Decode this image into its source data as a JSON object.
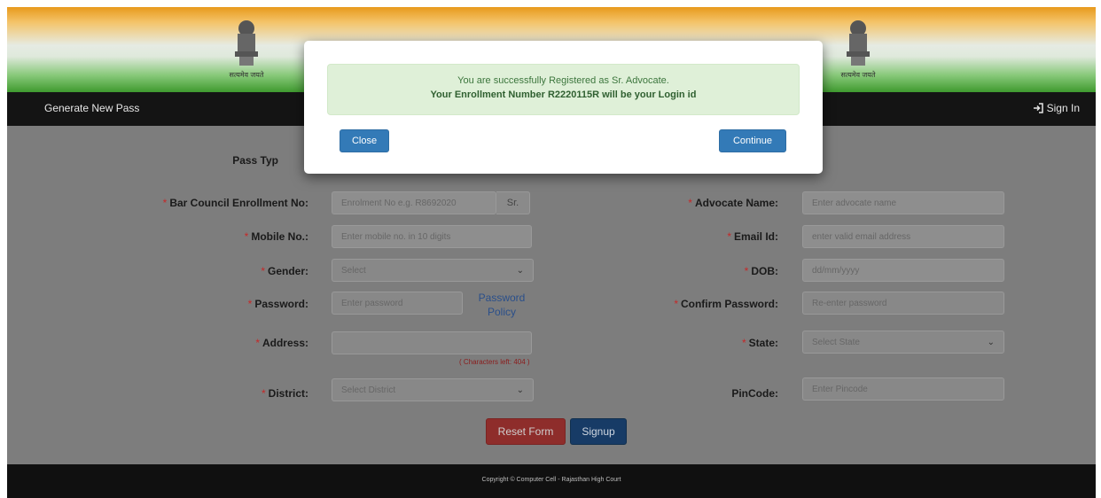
{
  "banner": {
    "emblem_motto": "सत्यमेव जयते"
  },
  "nav": {
    "left_link": "Generate New Pass",
    "sign_in": "Sign In"
  },
  "form": {
    "pass_type_label": "Pass Typ",
    "enrollment": {
      "label": "Bar Council Enrollment No:",
      "placeholder": "Enrolment No e.g. R8692020",
      "suffix": "Sr."
    },
    "advocate_name": {
      "label": "Advocate Name:",
      "placeholder": "Enter advocate name"
    },
    "mobile": {
      "label": "Mobile No.:",
      "placeholder": "Enter mobile no. in 10 digits"
    },
    "email": {
      "label": "Email Id:",
      "placeholder": "enter valid email address"
    },
    "gender": {
      "label": "Gender:",
      "value": "Select"
    },
    "dob": {
      "label": "DOB:",
      "placeholder": "dd/mm/yyyy"
    },
    "password": {
      "label": "Password:",
      "placeholder": "Enter password",
      "policy_line1": "Password",
      "policy_line2": "Policy"
    },
    "confirm_password": {
      "label": "Confirm Password:",
      "placeholder": "Re-enter password"
    },
    "address": {
      "label": "Address:",
      "value": "",
      "chars_left": "( Characters left: 404 )"
    },
    "state": {
      "label": "State:",
      "value": "Select State"
    },
    "district": {
      "label": "District:",
      "value": "Select District"
    },
    "pincode": {
      "label": "PinCode:",
      "placeholder": "Enter Pincode"
    },
    "reset_label": "Reset Form",
    "signup_label": "Signup"
  },
  "footer": {
    "copyright": "Copyright © Computer Cell - Rajasthan High Court"
  },
  "modal": {
    "message_line1": "You are successfully Registered as Sr. Advocate.",
    "message_line2": "Your Enrollment Number R2220115R will be your Login id",
    "close_label": "Close",
    "continue_label": "Continue"
  },
  "colors": {
    "modal_primary": "#337ab7",
    "success_bg": "#dff0d8",
    "reset_button": "#d9534f",
    "signup_button": "#1f4e8c",
    "required_marker": "#c62828"
  },
  "icons": {
    "sign_in_icon": "sign-in-icon",
    "emblem": "national-emblem-icon"
  }
}
